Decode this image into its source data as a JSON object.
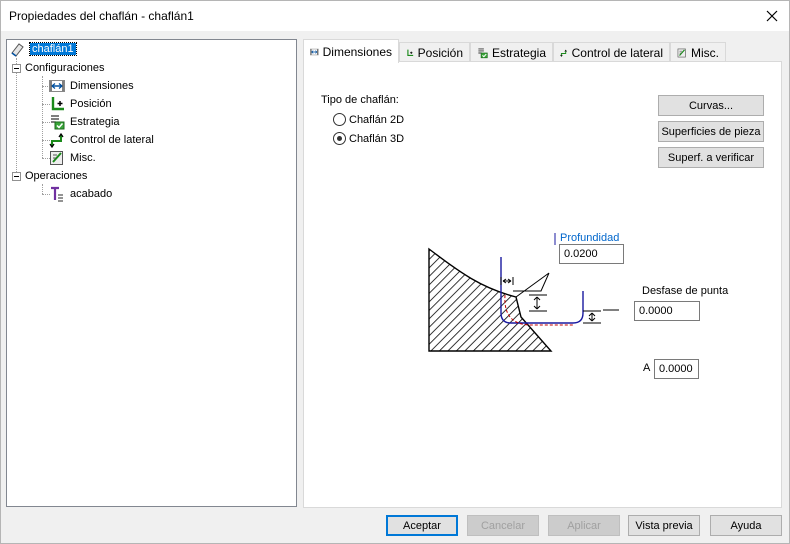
{
  "window": {
    "title": "Propiedades del chaflán - chaflán1"
  },
  "tree": {
    "root": "chaflán1",
    "configs_label": "Configuraciones",
    "config_items": [
      "Dimensiones",
      "Posición",
      "Estrategia",
      "Control de lateral",
      "Misc."
    ],
    "ops_label": "Operaciones",
    "op_items": [
      "acabado"
    ]
  },
  "tabs": [
    "Dimensiones",
    "Posición",
    "Estrategia",
    "Control de lateral",
    "Misc."
  ],
  "panel": {
    "tipo_label": "Tipo de chaflán:",
    "radio_2d": "Chaflán 2D",
    "radio_3d": "Chaflán 3D",
    "selected": "Chaflán 3D",
    "btn_curvas": "Curvas...",
    "btn_superficies": "Superficies de pieza",
    "btn_verificar": "Superf. a verificar",
    "profundidad_label": "Profundidad",
    "profundidad_value": "0.0200",
    "desfase_label": "Desfase de punta",
    "desfase_value": "0.0000",
    "a_label": "A",
    "a_value": "0.0000"
  },
  "footer": {
    "aceptar": "Aceptar",
    "cancelar": "Cancelar",
    "aplicar": "Aplicar",
    "vista_previa": "Vista previa",
    "ayuda": "Ayuda"
  }
}
